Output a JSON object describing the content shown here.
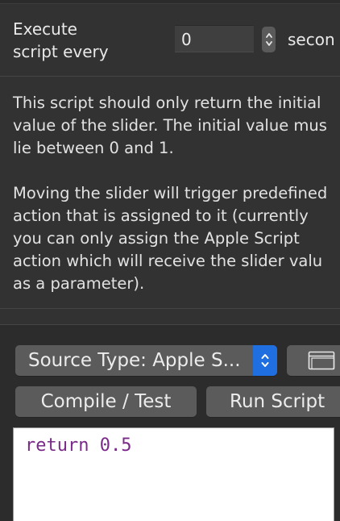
{
  "schedule": {
    "label": "Execute\nscript every",
    "interval_value": "0",
    "unit_label": "secon"
  },
  "description": {
    "lines_1": [
      "This script should only return the initial",
      "value of the slider. The initial value mus",
      "lie between 0 and 1."
    ],
    "lines_2": [
      "Moving the slider will trigger predefined",
      "action that is assigned to it (currently",
      "you can only assign the Apple Script",
      "action which will receive the slider valu",
      "as a parameter)."
    ]
  },
  "source": {
    "type_label": "Source Type: Apple S..."
  },
  "actions": {
    "compile_label": "Compile / Test",
    "run_label": "Run Script"
  },
  "editor": {
    "code": "return 0.5"
  },
  "colors": {
    "background": "#323232",
    "accent": "#1f6fe0",
    "code_text": "#7a2a88"
  }
}
